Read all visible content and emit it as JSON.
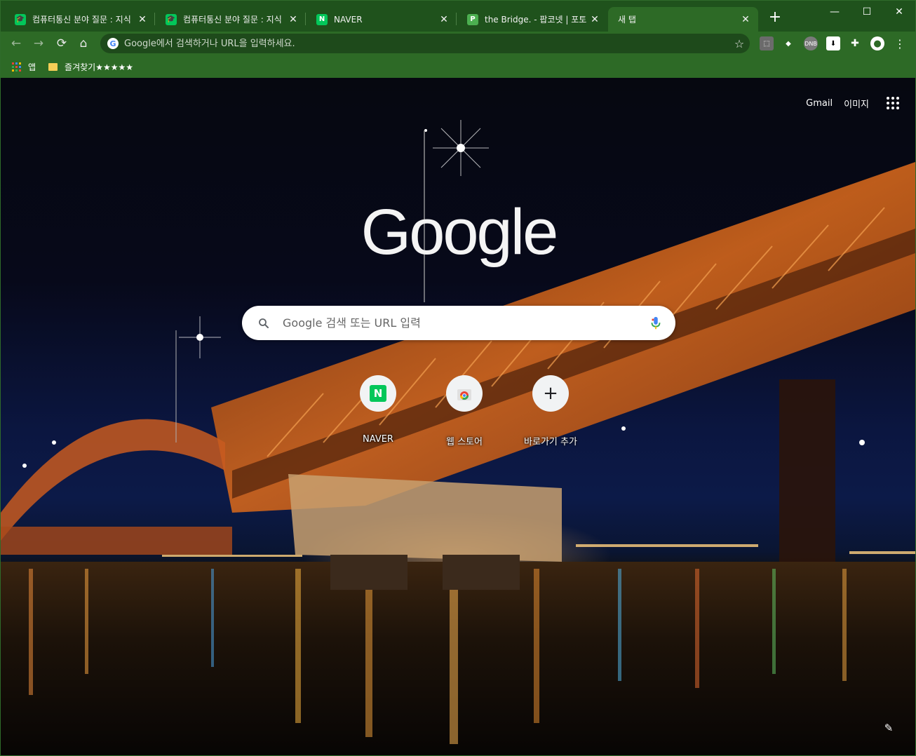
{
  "tabs": [
    {
      "title": "컴퓨터통신 분야 질문 : 지식",
      "favicon": "graduation-cap-icon",
      "favicon_color": "#03c75a",
      "close": "✕"
    },
    {
      "title": "컴퓨터통신 분야 질문 : 지식",
      "favicon": "graduation-cap-icon",
      "favicon_color": "#03c75a",
      "close": "✕"
    },
    {
      "title": "NAVER",
      "favicon": "naver-icon",
      "favicon_text": "N",
      "favicon_color": "#03c75a",
      "close": "✕"
    },
    {
      "title": "the Bridge. - 팝코넷 | 포토",
      "favicon": "popco-icon",
      "favicon_text": "P",
      "favicon_color": "#4caf50",
      "close": "✕"
    },
    {
      "title": "새 탭",
      "favicon": "",
      "close": "✕",
      "active": true
    }
  ],
  "omnibox": {
    "placeholder": "Google에서 검색하거나 URL을 입력하세요.",
    "value": ""
  },
  "bookmarks": [
    {
      "label": "앱",
      "icon": "apps-grid-icon"
    },
    {
      "label": "즐겨찾기★★★★★",
      "icon": "folder-icon"
    }
  ],
  "ntp": {
    "gmail_label": "Gmail",
    "images_label": "이미지",
    "logo_text": "Google",
    "search_placeholder": "Google 검색 또는 URL 입력",
    "shortcuts": [
      {
        "label": "NAVER",
        "icon": "naver-icon"
      },
      {
        "label": "웹 스토어",
        "icon": "chrome-web-store-icon"
      },
      {
        "label": "바로가기 추가",
        "icon": "plus-icon"
      }
    ]
  },
  "colors": {
    "frame": "#1f521c",
    "toolbar": "#2d6a26",
    "omnibox": "#1e4a1b",
    "naver": "#03c75a"
  }
}
